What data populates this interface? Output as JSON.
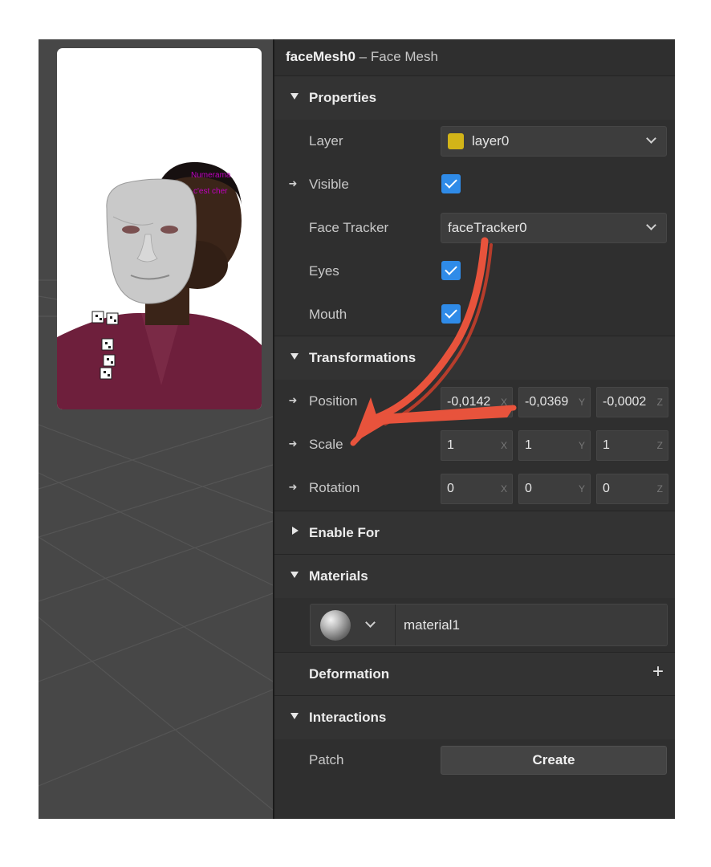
{
  "header": {
    "object_name": "faceMesh0",
    "object_type": "– Face Mesh"
  },
  "viewport": {
    "overlay_line1": "Numerama",
    "overlay_line2": "c'est cher"
  },
  "properties": {
    "section_label": "Properties",
    "layer_label": "Layer",
    "layer_value": "layer0",
    "layer_color": "#d2b418",
    "visible_label": "Visible",
    "visible_checked": true,
    "face_tracker_label": "Face Tracker",
    "face_tracker_value": "faceTracker0",
    "eyes_label": "Eyes",
    "eyes_checked": true,
    "mouth_label": "Mouth",
    "mouth_checked": true
  },
  "transformations": {
    "section_label": "Transformations",
    "position_label": "Position",
    "position": {
      "x": "-0,0142",
      "y": "-0,0369",
      "z": "-0,0002"
    },
    "scale_label": "Scale",
    "scale": {
      "x": "1",
      "y": "1",
      "z": "1"
    },
    "rotation_label": "Rotation",
    "rotation": {
      "x": "0",
      "y": "0",
      "z": "0"
    },
    "axis_labels": {
      "x": "X",
      "y": "Y",
      "z": "Z"
    }
  },
  "enable_for": {
    "section_label": "Enable For"
  },
  "materials": {
    "section_label": "Materials",
    "material_name": "material1"
  },
  "deformation": {
    "section_label": "Deformation",
    "add_symbol": "+"
  },
  "interactions": {
    "section_label": "Interactions",
    "patch_label": "Patch",
    "create_label": "Create"
  },
  "icons": {
    "expand": "triangle-down-icon",
    "collapsed": "triangle-right-icon",
    "link": "arrow-right-icon",
    "check": "checkmark-icon",
    "chevron": "chevron-down-icon"
  },
  "colors": {
    "accent": "#2f8be8",
    "annotation_arrow": "#e8533c",
    "panel_bg": "#2f2f2f"
  }
}
